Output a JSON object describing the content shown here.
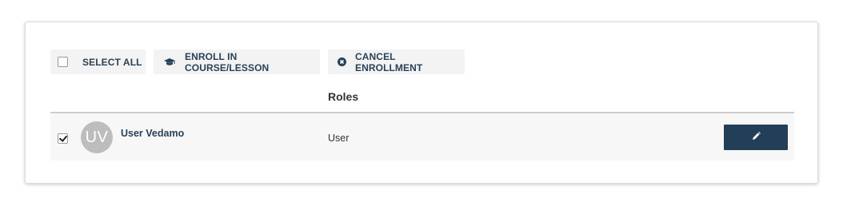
{
  "toolbar": {
    "select_all_label": "SELECT ALL",
    "enroll_label": "ENROLL IN COURSE/LESSON",
    "cancel_label": "CANCEL ENROLLMENT"
  },
  "table": {
    "columns": [
      "",
      "Roles"
    ],
    "rows": [
      {
        "selected": true,
        "avatar_initials": "UV",
        "name": "User Vedamo",
        "role": "User"
      }
    ]
  },
  "icons": {
    "enroll": "graduation-cap-icon",
    "cancel": "circle-x-icon",
    "edit": "pencil-icon"
  },
  "colors": {
    "accent": "#233f57",
    "text_dark_blue": "#2a4256",
    "button_bg": "#f3f3f3",
    "row_bg": "#f7f7f7",
    "avatar_bg": "#bdbdbd"
  }
}
